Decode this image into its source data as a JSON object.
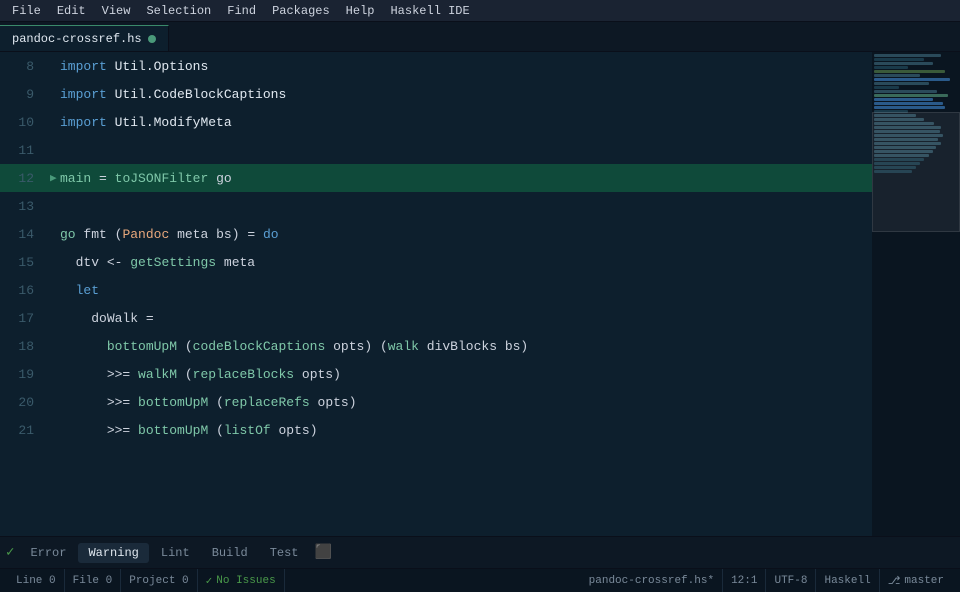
{
  "menu": {
    "items": [
      "File",
      "Edit",
      "View",
      "Selection",
      "Find",
      "Packages",
      "Help",
      "Haskell IDE"
    ]
  },
  "tab": {
    "filename": "pandoc-crossref.hs",
    "modified": true
  },
  "editor": {
    "lines": [
      {
        "num": 8,
        "indicator": "",
        "content": [
          {
            "t": "kw",
            "v": "import"
          },
          {
            "t": "sp",
            "v": " "
          },
          {
            "t": "mod",
            "v": "Util.Options"
          }
        ],
        "highlight": false
      },
      {
        "num": 9,
        "indicator": "",
        "content": [
          {
            "t": "kw",
            "v": "import"
          },
          {
            "t": "sp",
            "v": " "
          },
          {
            "t": "mod",
            "v": "Util.CodeBlockCaptions"
          }
        ],
        "highlight": false
      },
      {
        "num": 10,
        "indicator": "",
        "content": [
          {
            "t": "kw",
            "v": "import"
          },
          {
            "t": "sp",
            "v": " "
          },
          {
            "t": "mod",
            "v": "Util.ModifyMeta"
          }
        ],
        "highlight": false
      },
      {
        "num": 11,
        "indicator": "",
        "content": [],
        "highlight": false
      },
      {
        "num": 12,
        "indicator": "arrow",
        "content": [
          {
            "t": "fn",
            "v": "main"
          },
          {
            "t": "sp",
            "v": " "
          },
          {
            "t": "op",
            "v": "="
          },
          {
            "t": "sp",
            "v": " "
          },
          {
            "t": "fn",
            "v": "toJSONFilter"
          },
          {
            "t": "sp",
            "v": " "
          },
          {
            "t": "var",
            "v": "go"
          }
        ],
        "highlight": true
      },
      {
        "num": 13,
        "indicator": "",
        "content": [],
        "highlight": false
      },
      {
        "num": 14,
        "indicator": "",
        "content": [
          {
            "t": "fn",
            "v": "go"
          },
          {
            "t": "sp",
            "v": " "
          },
          {
            "t": "var",
            "v": "fmt"
          },
          {
            "t": "sp",
            "v": " "
          },
          {
            "t": "op",
            "v": "("
          },
          {
            "t": "type",
            "v": "Pandoc"
          },
          {
            "t": "sp",
            "v": " "
          },
          {
            "t": "var",
            "v": "meta"
          },
          {
            "t": "sp",
            "v": " "
          },
          {
            "t": "var",
            "v": "bs"
          },
          {
            "t": "op",
            "v": ")"
          },
          {
            "t": "sp",
            "v": " "
          },
          {
            "t": "op",
            "v": "="
          },
          {
            "t": "sp",
            "v": " "
          },
          {
            "t": "kw",
            "v": "do"
          }
        ],
        "highlight": false
      },
      {
        "num": 15,
        "indicator": "",
        "content": [
          {
            "t": "sp",
            "v": "  "
          },
          {
            "t": "var",
            "v": "dtv"
          },
          {
            "t": "sp",
            "v": " "
          },
          {
            "t": "op",
            "v": "<-"
          },
          {
            "t": "sp",
            "v": " "
          },
          {
            "t": "fn",
            "v": "getSettings"
          },
          {
            "t": "sp",
            "v": " "
          },
          {
            "t": "var",
            "v": "meta"
          }
        ],
        "highlight": false
      },
      {
        "num": 16,
        "indicator": "",
        "content": [
          {
            "t": "sp",
            "v": "  "
          },
          {
            "t": "kw",
            "v": "let"
          }
        ],
        "highlight": false
      },
      {
        "num": 17,
        "indicator": "",
        "content": [
          {
            "t": "sp",
            "v": "    "
          },
          {
            "t": "var",
            "v": "doWalk"
          },
          {
            "t": "sp",
            "v": " "
          },
          {
            "t": "op",
            "v": "="
          }
        ],
        "highlight": false
      },
      {
        "num": 18,
        "indicator": "",
        "content": [
          {
            "t": "sp",
            "v": "      "
          },
          {
            "t": "fn",
            "v": "bottomUpM"
          },
          {
            "t": "sp",
            "v": " "
          },
          {
            "t": "op",
            "v": "("
          },
          {
            "t": "fn",
            "v": "codeBlockCaptions"
          },
          {
            "t": "sp",
            "v": " "
          },
          {
            "t": "var",
            "v": "opts"
          },
          {
            "t": "op",
            "v": ")"
          },
          {
            "t": "sp",
            "v": " "
          },
          {
            "t": "op",
            "v": "("
          },
          {
            "t": "fn",
            "v": "walk"
          },
          {
            "t": "sp",
            "v": " "
          },
          {
            "t": "var",
            "v": "divBlocks"
          },
          {
            "t": "sp",
            "v": " "
          },
          {
            "t": "var",
            "v": "bs"
          },
          {
            "t": "op",
            "v": ")"
          }
        ],
        "highlight": false
      },
      {
        "num": 19,
        "indicator": "",
        "content": [
          {
            "t": "sp",
            "v": "      "
          },
          {
            "t": "op",
            "v": ">>="
          },
          {
            "t": "sp",
            "v": " "
          },
          {
            "t": "fn",
            "v": "walkM"
          },
          {
            "t": "sp",
            "v": " "
          },
          {
            "t": "op",
            "v": "("
          },
          {
            "t": "fn",
            "v": "replaceBlocks"
          },
          {
            "t": "sp",
            "v": " "
          },
          {
            "t": "var",
            "v": "opts"
          },
          {
            "t": "op",
            "v": ")"
          }
        ],
        "highlight": false
      },
      {
        "num": 20,
        "indicator": "",
        "content": [
          {
            "t": "sp",
            "v": "      "
          },
          {
            "t": "op",
            "v": ">>="
          },
          {
            "t": "sp",
            "v": " "
          },
          {
            "t": "fn",
            "v": "bottomUpM"
          },
          {
            "t": "sp",
            "v": " "
          },
          {
            "t": "op",
            "v": "("
          },
          {
            "t": "fn",
            "v": "replaceRefs"
          },
          {
            "t": "sp",
            "v": " "
          },
          {
            "t": "var",
            "v": "opts"
          },
          {
            "t": "op",
            "v": ")"
          }
        ],
        "highlight": false
      },
      {
        "num": 21,
        "indicator": "",
        "content": [
          {
            "t": "sp",
            "v": "      "
          },
          {
            "t": "op",
            "v": ">>="
          },
          {
            "t": "sp",
            "v": " "
          },
          {
            "t": "fn",
            "v": "bottomUpM"
          },
          {
            "t": "sp",
            "v": " "
          },
          {
            "t": "op",
            "v": "("
          },
          {
            "t": "fn",
            "v": "listOf"
          },
          {
            "t": "sp",
            "v": " "
          },
          {
            "t": "var",
            "v": "opts"
          },
          {
            "t": "op",
            "v": ")"
          }
        ],
        "highlight": false
      }
    ]
  },
  "minimap": {
    "lines": [
      {
        "w": "80%",
        "c": "#2a4a5a"
      },
      {
        "w": "60%",
        "c": "#1a3a4a"
      },
      {
        "w": "70%",
        "c": "#2a4a5a"
      },
      {
        "w": "40%",
        "c": "#1a3a4a"
      },
      {
        "w": "85%",
        "c": "#3a5a3a"
      },
      {
        "w": "55%",
        "c": "#2a4a5a"
      },
      {
        "w": "90%",
        "c": "#2a5a8a"
      },
      {
        "w": "65%",
        "c": "#2a4a5a"
      },
      {
        "w": "30%",
        "c": "#1a3a4a"
      },
      {
        "w": "75%",
        "c": "#2a4a5a"
      },
      {
        "w": "88%",
        "c": "#3a6a5a"
      },
      {
        "w": "70%",
        "c": "#2a5a8a"
      },
      {
        "w": "82%",
        "c": "#2a5a8a"
      },
      {
        "w": "85%",
        "c": "#2a5a8a"
      },
      {
        "w": "40%",
        "c": "#1a3a4a"
      },
      {
        "w": "50%",
        "c": "#2a4a5a"
      },
      {
        "w": "60%",
        "c": "#2a4a5a"
      },
      {
        "w": "72%",
        "c": "#2a4a5a"
      },
      {
        "w": "80%",
        "c": "#2a4a5a"
      },
      {
        "w": "78%",
        "c": "#2a4a5a"
      },
      {
        "w": "82%",
        "c": "#2a4a5a"
      },
      {
        "w": "76%",
        "c": "#2a4a5a"
      },
      {
        "w": "80%",
        "c": "#2a4a5a"
      },
      {
        "w": "74%",
        "c": "#2a4a5a"
      },
      {
        "w": "70%",
        "c": "#2a4a5a"
      },
      {
        "w": "65%",
        "c": "#2a4a5a"
      },
      {
        "w": "60%",
        "c": "#1a3a4a"
      },
      {
        "w": "55%",
        "c": "#1a3a4a"
      },
      {
        "w": "50%",
        "c": "#1a3a4a"
      },
      {
        "w": "45%",
        "c": "#1a3a4a"
      }
    ]
  },
  "panel": {
    "tabs": [
      {
        "label": "Error",
        "active": false
      },
      {
        "label": "Warning",
        "active": true
      },
      {
        "label": "Lint",
        "active": false
      },
      {
        "label": "Build",
        "active": false
      },
      {
        "label": "Test",
        "active": false
      }
    ]
  },
  "statusbar": {
    "line": "Line 0",
    "file": "File 0",
    "project": "Project 0",
    "issues": "No Issues",
    "filename": "pandoc-crossref.hs*",
    "position": "12:1",
    "encoding": "UTF-8",
    "language": "Haskell",
    "branch": "master"
  }
}
